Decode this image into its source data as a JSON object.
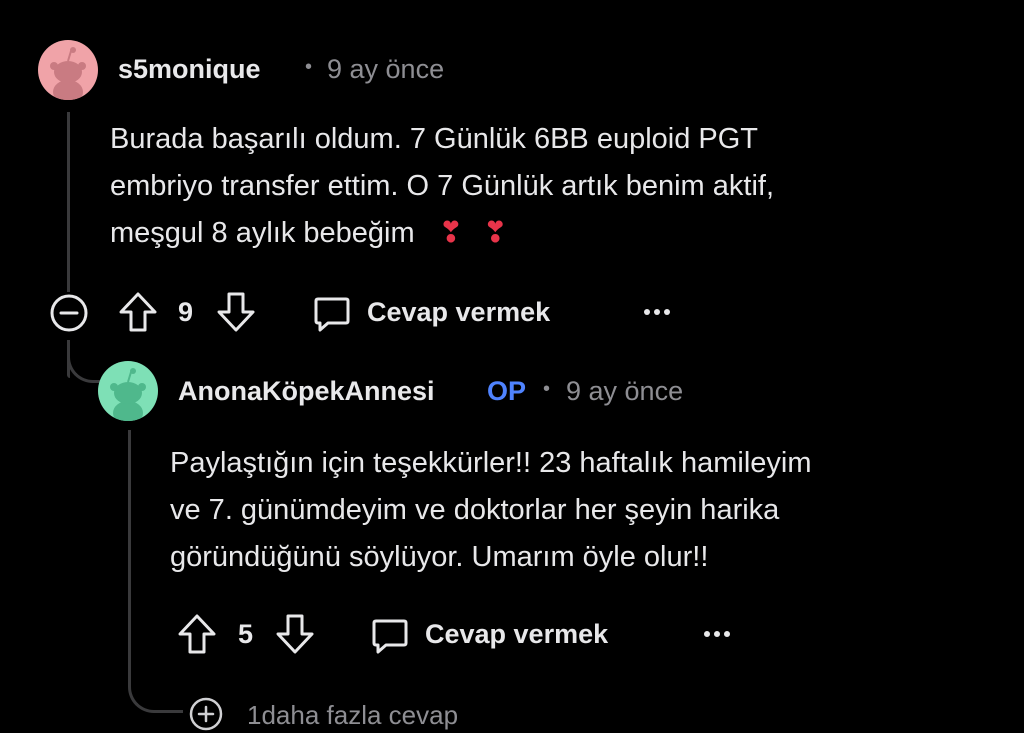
{
  "comment1": {
    "username": "s5monique",
    "separator": "•",
    "time": "9 ay önce",
    "avatar_color": "#f0a3a8",
    "lines": [
      "Burada başarılı oldum. 7 Günlük 6BB euploid PGT",
      "embriyo transfer ettim. O 7 Günlük artık benim aktif",
      "meşgul 8 aylık bebeğim"
    ],
    "line2_comma": ",",
    "emoji": "❣️ ❣️",
    "votes": "9",
    "reply_label": "Cevap vermek",
    "more_icon": "ellipsis-icon"
  },
  "comment2": {
    "username": "AnonaKöpekAnnesi",
    "op_badge": "OP",
    "separator": "•",
    "time": "9 ay önce",
    "avatar_color": "#7ee0b6",
    "lines": [
      "Paylaştığın için teşekkürler!! 23 haftalık hamileyim",
      "ve 7. günümdeyim ve doktorlar her şeyin harika",
      "göründüğünü söylüyor. Umarım öyle olur!!"
    ],
    "votes": "5",
    "reply_label": "Cevap vermek",
    "more_icon": "ellipsis-icon"
  },
  "more_replies": {
    "label": "1daha fazla cevap",
    "icon": "plus-circle-icon"
  },
  "colors": {
    "background": "#000000",
    "text": "#e8e8ea",
    "muted": "#8e8e93",
    "op": "#4f83ff",
    "heart": "#e8344a"
  }
}
